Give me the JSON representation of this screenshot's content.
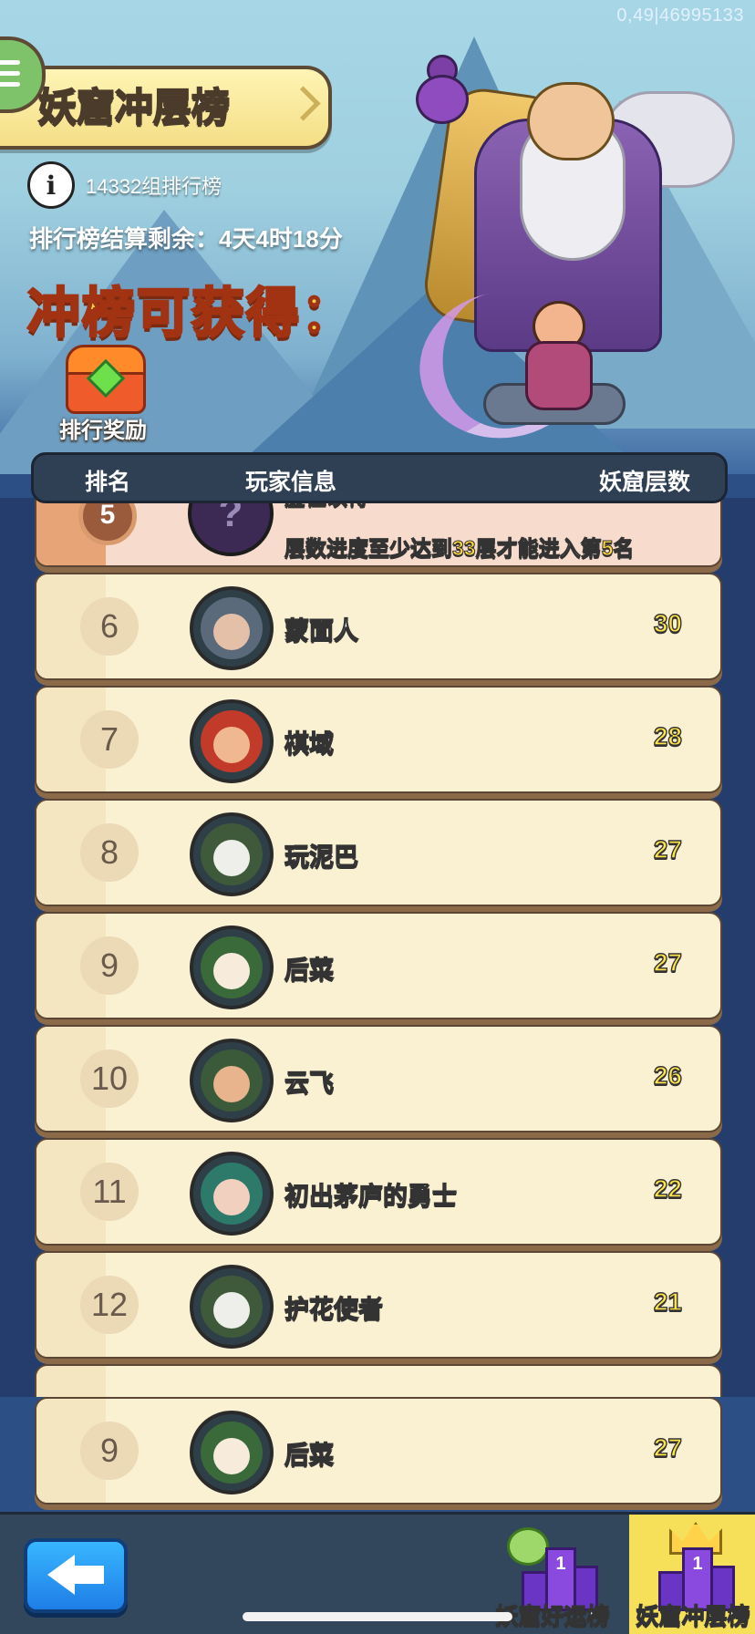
{
  "status": {
    "version_label": "0,49|46995133"
  },
  "header": {
    "title": "妖窟冲层榜",
    "group_label": "14332组排行榜",
    "countdown": "排行榜结算剩余：4天4时18分",
    "rewards_heading": "冲榜可获得：",
    "reward_item_label": "排行奖励"
  },
  "table": {
    "columns": {
      "rank": "排名",
      "player": "玩家信息",
      "floors": "妖窟层数"
    },
    "placeholder_row": {
      "rank": "5",
      "name": "虚位以待",
      "hint_prefix": "层数进度至少达到",
      "hint_floor": "33",
      "hint_mid": "层才能进入第",
      "hint_rank": "5",
      "hint_suffix": "名"
    },
    "rows": [
      {
        "rank": "6",
        "name": "蒙面人",
        "floors": "30"
      },
      {
        "rank": "7",
        "name": "棋域",
        "floors": "28"
      },
      {
        "rank": "8",
        "name": "玩泥巴",
        "floors": "27"
      },
      {
        "rank": "9",
        "name": "后菜",
        "floors": "27"
      },
      {
        "rank": "10",
        "name": "云飞",
        "floors": "26"
      },
      {
        "rank": "11",
        "name": "初出茅庐的勇士",
        "floors": "22"
      },
      {
        "rank": "12",
        "name": "护花使者",
        "floors": "21"
      }
    ],
    "my_row": {
      "rank": "9",
      "name": "后菜",
      "floors": "27"
    }
  },
  "bottom": {
    "tabs": [
      {
        "label": "妖窟好运榜"
      },
      {
        "label": "妖窟冲层榜"
      }
    ]
  },
  "colors": {
    "accent_yellow": "#ffe44a",
    "tab_active": "#f6e05a",
    "back_button": "#2a94f4"
  }
}
